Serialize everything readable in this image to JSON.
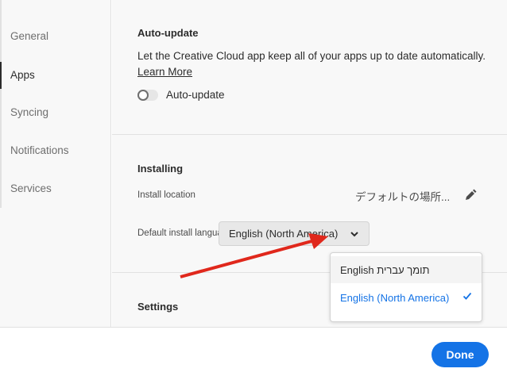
{
  "sidebar": {
    "items": [
      {
        "label": "General"
      },
      {
        "label": "Apps"
      },
      {
        "label": "Syncing"
      },
      {
        "label": "Notifications"
      },
      {
        "label": "Services"
      }
    ],
    "active": "Apps"
  },
  "autoupdate": {
    "heading": "Auto-update",
    "description": "Let the Creative Cloud app keep all of your apps up to date automatically.",
    "learn_more": "Learn More",
    "toggle_label": "Auto-update",
    "toggle_on": false
  },
  "installing": {
    "heading": "Installing",
    "location_label": "Install location",
    "location_value": "デフォルトの場所...",
    "language_label": "Default install language",
    "language_value": "English (North America)"
  },
  "language_menu": {
    "options": [
      "English תומך עברית",
      "English (North America)"
    ],
    "selected": "English (North America)"
  },
  "settings": {
    "heading": "Settings"
  },
  "footer": {
    "done_label": "Done"
  },
  "colors": {
    "accent": "#1473e6",
    "annotation_arrow": "#e0281c"
  }
}
